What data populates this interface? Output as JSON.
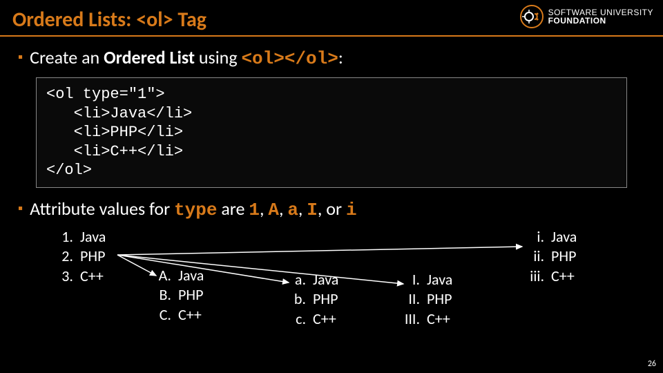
{
  "logo": {
    "line1": "SOFTWARE UNIVERSITY",
    "line2": "FOUNDATION"
  },
  "title": "Ordered Lists: <ol> Tag",
  "bullets": {
    "b1_pre": "Create an ",
    "b1_bold": "Ordered List",
    "b1_mid": " using ",
    "b1_code": "<ol></ol>",
    "b1_post": ":",
    "b2_pre": "Attribute values for ",
    "b2_type": "type",
    "b2_are": " are ",
    "b2_1": "1",
    "b2_sep": ", ",
    "b2_A": "A",
    "b2_a": "a",
    "b2_I": "I",
    "b2_or": ", or ",
    "b2_i": "i"
  },
  "code": {
    "l1": "<ol type=\"1\">",
    "l2": "   <li>Java</li>",
    "l3": "   <li>PHP</li>",
    "l4": "   <li>C++</li>",
    "l5": "</ol>"
  },
  "examples": {
    "items": [
      "Java",
      "PHP",
      "C++"
    ],
    "markers": {
      "num": [
        "1.",
        "2.",
        "3."
      ],
      "upperA": [
        "A.",
        "B.",
        "C."
      ],
      "lowerA": [
        "a.",
        "b.",
        "c."
      ],
      "upperI": [
        "I.",
        "II.",
        "III."
      ],
      "lowerI": [
        "i.",
        "ii.",
        "iii."
      ]
    }
  },
  "page_number": "26"
}
